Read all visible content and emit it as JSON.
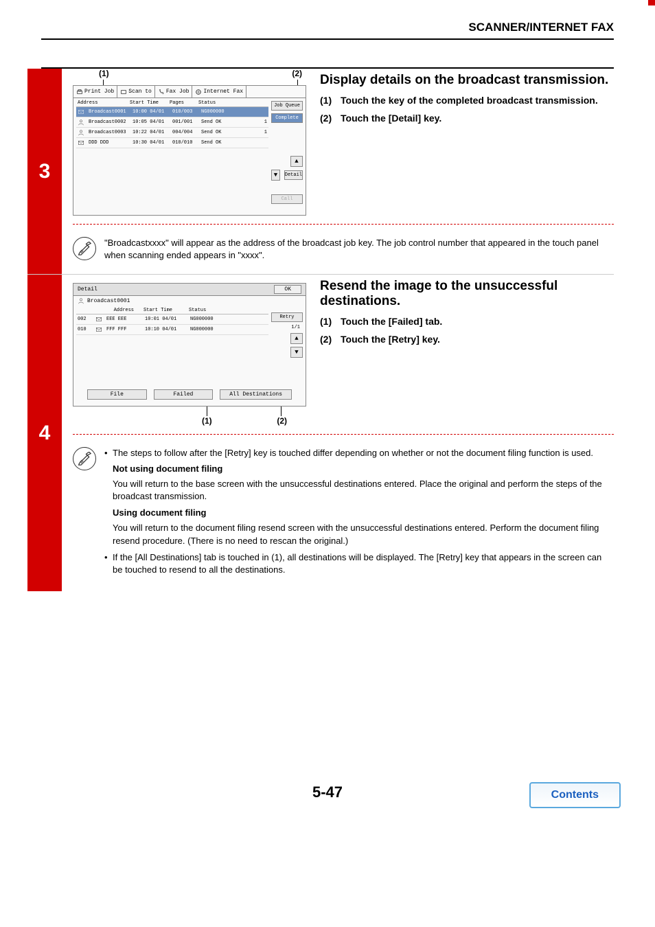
{
  "header": {
    "title": "SCANNER/INTERNET FAX"
  },
  "step3": {
    "number": "3",
    "callouts": {
      "c1": "(1)",
      "c2": "(2)"
    },
    "ui": {
      "tabs": {
        "print": "Print Job",
        "scan": "Scan to",
        "fax": "Fax Job",
        "ifax": "Internet Fax"
      },
      "headers": {
        "address": "Address",
        "start": "Start Time",
        "pages": "Pages",
        "status": "Status"
      },
      "rows": [
        {
          "addr": "Broadcast0001",
          "time": "10:00 04/01",
          "pages": "010/003",
          "status": "NG000000"
        },
        {
          "addr": "Broadcast0002",
          "time": "10:05 04/01",
          "pages": "001/001",
          "status": "Send OK",
          "seq": "1"
        },
        {
          "addr": "Broadcast0003",
          "time": "10:22 04/01",
          "pages": "004/004",
          "status": "Send OK",
          "seq": "1"
        },
        {
          "addr": "DDD DDD",
          "time": "10:30 04/01",
          "pages": "010/010",
          "status": "Send OK"
        }
      ],
      "side": {
        "jobq": "Job Queue",
        "complete": "Complete",
        "detail": "Detail",
        "call": "Call"
      }
    },
    "instr": {
      "title": "Display details on the broadcast transmission.",
      "items": [
        {
          "num": "(1)",
          "text": "Touch the key of the completed broadcast transmission."
        },
        {
          "num": "(2)",
          "text": "Touch the [Detail] key."
        }
      ]
    },
    "note": "\"Broadcastxxxx\" will appear as the address of the broadcast job key. The job control number that appeared in the touch panel when scanning ended appears in \"xxxx\"."
  },
  "step4": {
    "number": "4",
    "callouts": {
      "c1": "(1)",
      "c2": "(2)"
    },
    "ui": {
      "title": "Detail",
      "ok": "OK",
      "subtitle": "Broadcast0001",
      "headers": {
        "address": "Address",
        "start": "Start Time",
        "status": "Status"
      },
      "side": {
        "retry": "Retry"
      },
      "rows": [
        {
          "num": "002",
          "addr": "EEE EEE",
          "time": "10:01 04/01",
          "status": "NG000000"
        },
        {
          "num": "010",
          "addr": "FFF FFF",
          "time": "10:10 04/01",
          "status": "NG000000"
        }
      ],
      "scroll": "1/1",
      "btabs": {
        "file": "File",
        "failed": "Failed",
        "alldest": "All Destinations"
      }
    },
    "instr": {
      "title": "Resend the image to the unsuccessful destinations.",
      "items": [
        {
          "num": "(1)",
          "text": "Touch the [Failed] tab."
        },
        {
          "num": "(2)",
          "text": "Touch the [Retry] key."
        }
      ]
    },
    "notes": {
      "b1": "The steps to follow after the [Retry] key is touched differ depending on whether or not the document filing function is used.",
      "h1": "Not using document filing",
      "p1": "You will return to the base screen with the unsuccessful destinations entered. Place the original and perform the steps of the broadcast transmission.",
      "h2": "Using document filing",
      "p2": "You will return to the document filing resend screen with the unsuccessful destinations entered. Perform the document filing resend procedure. (There is no need to rescan the original.)",
      "b2": "If the [All Destinations] tab is touched in (1), all destinations will be displayed. The [Retry] key that appears in the screen can be touched to resend to all the destinations."
    }
  },
  "footer": {
    "page": "5-47",
    "contents": "Contents"
  }
}
